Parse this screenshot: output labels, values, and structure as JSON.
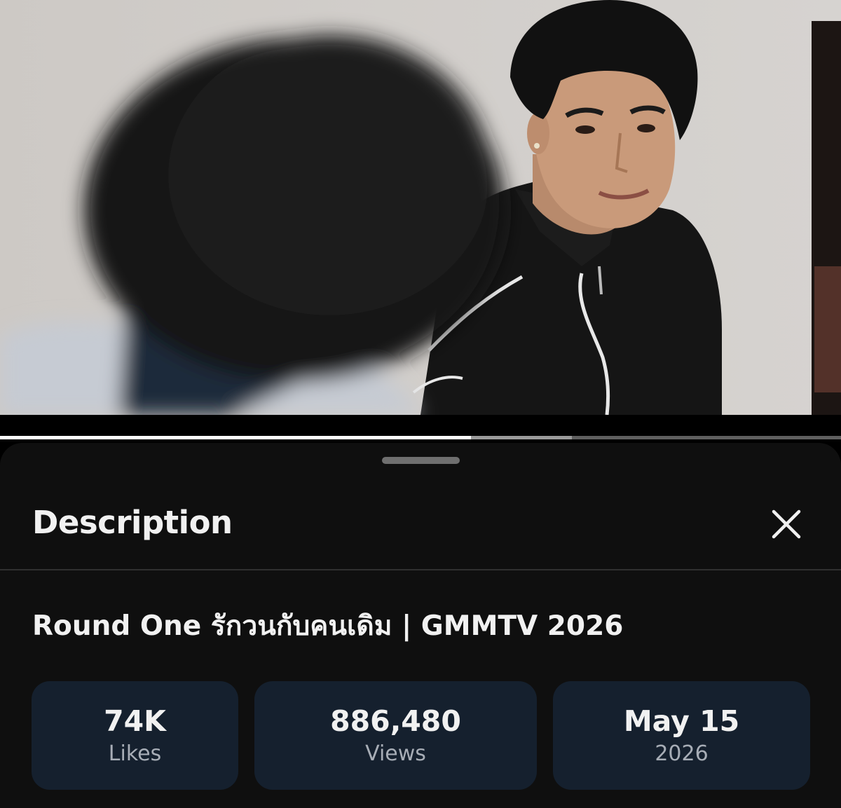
{
  "video": {
    "progress_played": 0.56,
    "progress_buffered": 0.68,
    "colors": {
      "wall": "#cfcbc7",
      "hair": "#111111",
      "jacket": "#151515",
      "skin": "#c99a7a",
      "stripe": "#e8e8e8"
    }
  },
  "description_panel": {
    "title": "Description",
    "close_icon": "close-icon",
    "video_title": "Round One รักวนกับคนเดิม | GMMTV 2026",
    "stats": {
      "likes": {
        "value": "74K",
        "label": "Likes"
      },
      "views": {
        "value": "886,480",
        "label": "Views"
      },
      "date": {
        "value": "May 15",
        "label": "2026"
      }
    }
  },
  "theme": {
    "sheet_bg": "#0f0f0f",
    "stat_bg": "#15202e",
    "text_primary": "#f1f1f1",
    "text_secondary": "#a7adb6"
  }
}
